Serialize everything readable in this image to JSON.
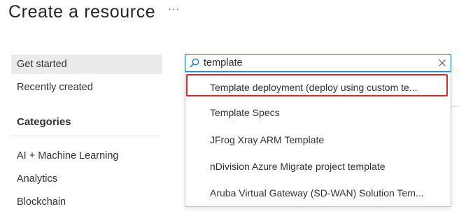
{
  "header": {
    "title": "Create a resource",
    "more_label": "···"
  },
  "nav": {
    "items": [
      {
        "label": "Get started",
        "selected": true
      },
      {
        "label": "Recently created",
        "selected": false
      }
    ],
    "categories_heading": "Categories",
    "categories": [
      {
        "label": "AI + Machine Learning"
      },
      {
        "label": "Analytics"
      },
      {
        "label": "Blockchain"
      }
    ]
  },
  "search": {
    "value": "template",
    "placeholder": ""
  },
  "suggestions": [
    {
      "label": "Template deployment (deploy using custom te...",
      "highlighted": true
    },
    {
      "label": "Template Specs",
      "highlighted": false
    },
    {
      "label": "JFrog Xray ARM Template",
      "highlighted": false
    },
    {
      "label": "nDivision Azure Migrate project template",
      "highlighted": false
    },
    {
      "label": "Aruba Virtual Gateway (SD-WAN) Solution Tem...",
      "highlighted": false
    }
  ],
  "colors": {
    "accent": "#0078d4",
    "highlight_border": "#d42a2a",
    "selected_bg": "#edebe9"
  },
  "icons": {
    "search": "search-icon",
    "clear": "close-icon",
    "more": "more-icon"
  }
}
